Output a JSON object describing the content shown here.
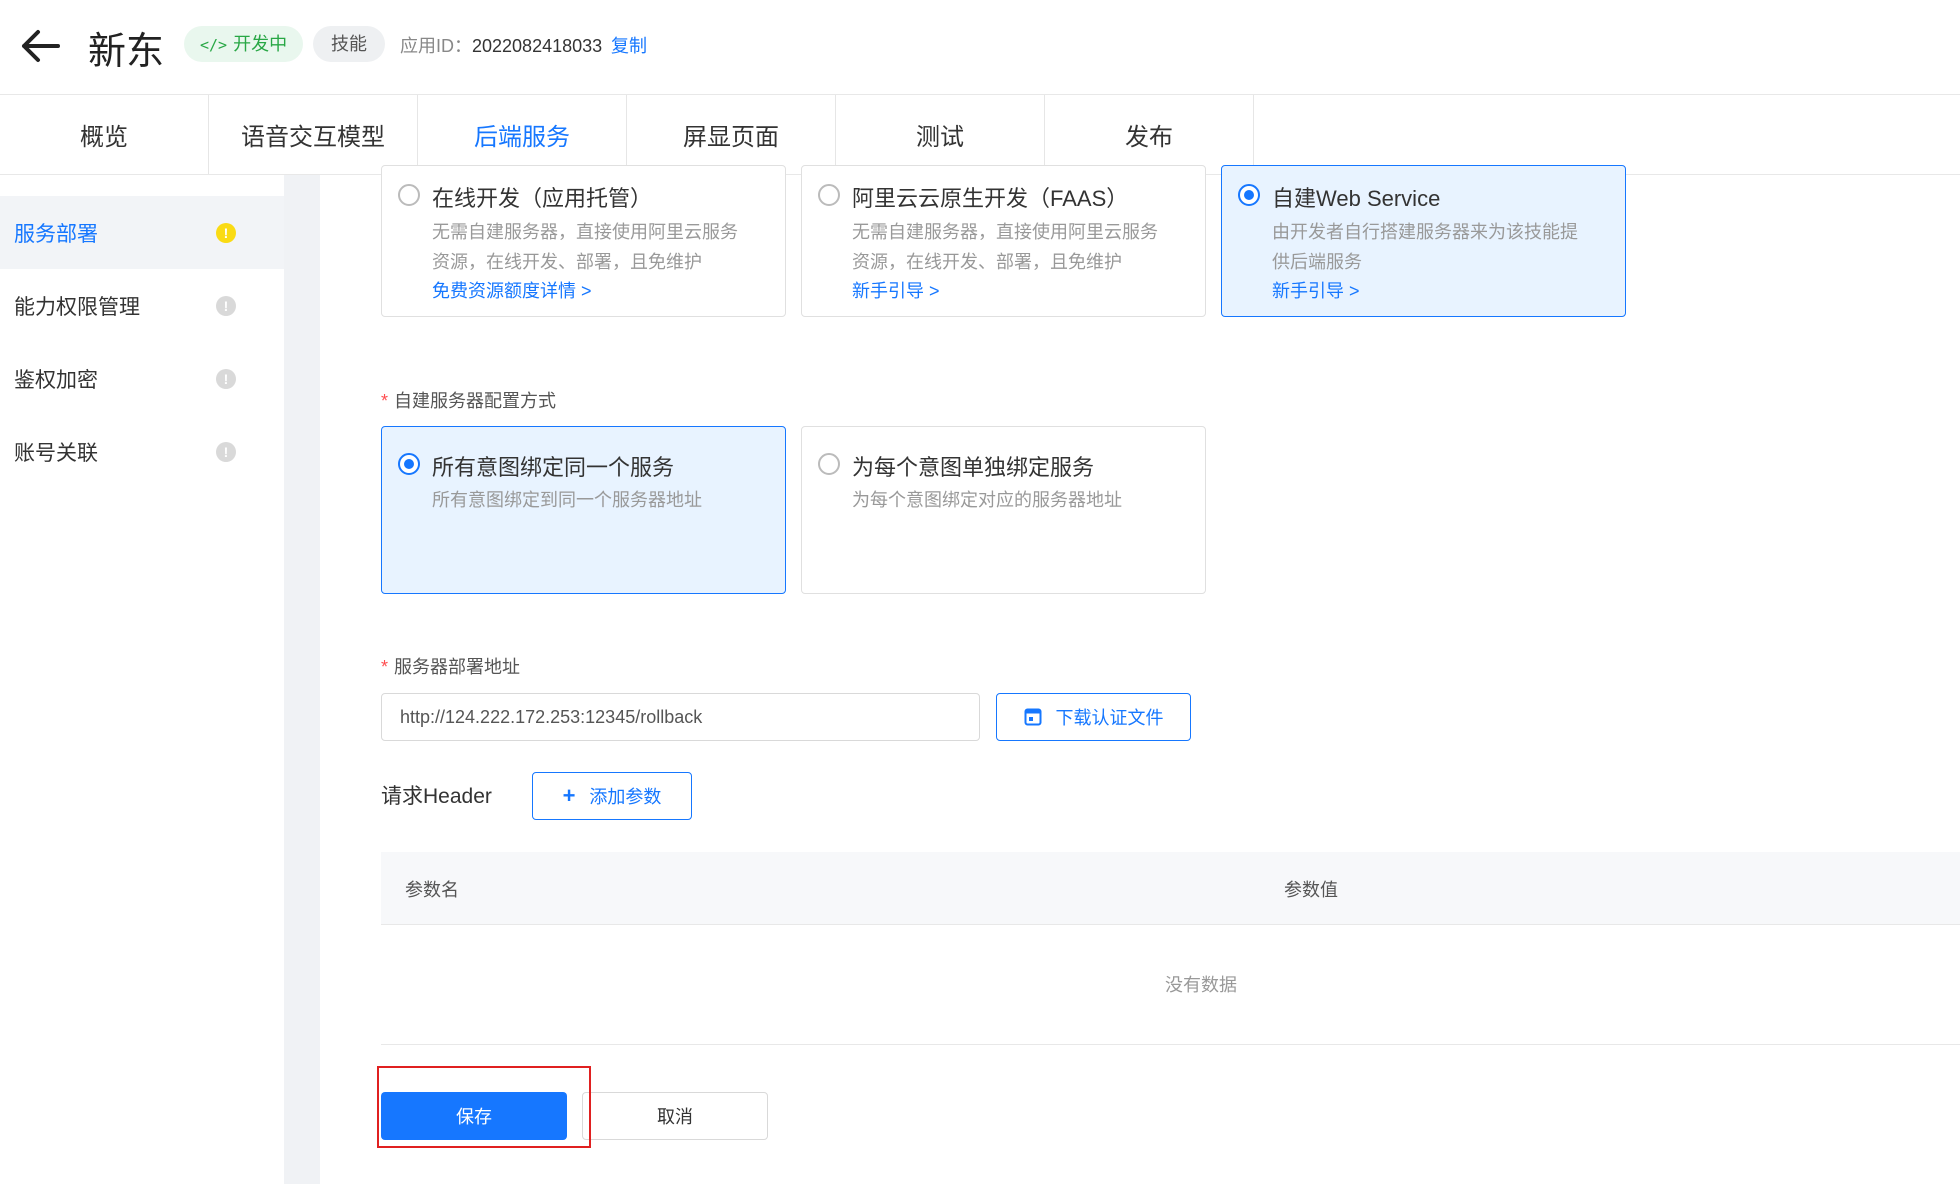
{
  "header": {
    "app_name": "新东",
    "status_icon": "</>",
    "status": "开发中",
    "type": "技能",
    "appid_label": "应用ID：",
    "appid_value": "2022082418033",
    "copy": "复制"
  },
  "tabs": [
    {
      "label": "概览"
    },
    {
      "label": "语音交互模型"
    },
    {
      "label": "后端服务"
    },
    {
      "label": "屏显页面"
    },
    {
      "label": "测试"
    },
    {
      "label": "发布"
    }
  ],
  "active_tab": "后端服务",
  "sidebar": {
    "items": [
      {
        "label": "服务部署",
        "badge": "!"
      },
      {
        "label": "能力权限管理",
        "badge": "!"
      },
      {
        "label": "鉴权加密",
        "badge": "!"
      },
      {
        "label": "账号关联",
        "badge": "!"
      }
    ]
  },
  "deploy_options": [
    {
      "title": "在线开发（应用托管）",
      "desc1": "无需自建服务器，直接使用阿里云服务",
      "desc2": "资源，在线开发、部署，且免维护",
      "link": "免费资源额度详情 >",
      "selected": false
    },
    {
      "title": "阿里云云原生开发（FAAS）",
      "desc1": "无需自建服务器，直接使用阿里云服务",
      "desc2": "资源，在线开发、部署，且免维护",
      "link": "新手引导 >",
      "selected": false
    },
    {
      "title": "自建Web Service",
      "desc1": "由开发者自行搭建服务器来为该技能提",
      "desc2": "供后端服务",
      "link": "新手引导 >",
      "selected": true
    }
  ],
  "config": {
    "label": "自建服务器配置方式",
    "required_mark": "*",
    "options": [
      {
        "title": "所有意图绑定同一个服务",
        "desc": "所有意图绑定到同一个服务器地址",
        "selected": true
      },
      {
        "title": "为每个意图单独绑定服务",
        "desc": "为每个意图绑定对应的服务器地址",
        "selected": false
      }
    ]
  },
  "server": {
    "label": "服务器部署地址",
    "required_mark": "*",
    "url": "http://124.222.172.253:12345/rollback",
    "download_label": "下载认证文件"
  },
  "request_header": {
    "label": "请求Header",
    "add_label": "添加参数",
    "add_icon": "+",
    "col_name": "参数名",
    "col_value": "参数值",
    "empty": "没有数据"
  },
  "actions": {
    "save": "保存",
    "cancel": "取消"
  },
  "colors": {
    "accent": "#1677ff",
    "success": "#28a745",
    "warning": "#fadb14",
    "highlight": "#e02020"
  }
}
